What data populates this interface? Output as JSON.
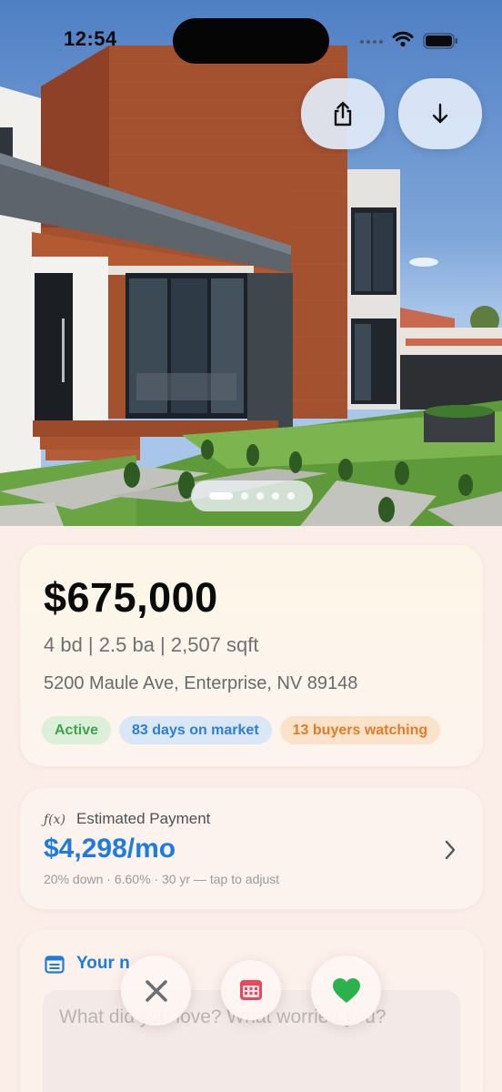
{
  "status_bar": {
    "time": "12:54"
  },
  "hero": {
    "photo_count": 5,
    "active_photo_index": 0,
    "share_icon": "share-icon",
    "download_icon": "arrow-down-icon"
  },
  "listing": {
    "price": "$675,000",
    "specs": "4 bd | 2.5 ba | 2,507 sqft",
    "address": "5200 Maule Ave, Enterprise, NV 89148",
    "badges": {
      "status": "Active",
      "days_on_market": "83 days on market",
      "buyers_watching": "13 buyers watching"
    }
  },
  "payment": {
    "icon": "ƒ(x)",
    "label": "Estimated Payment",
    "amount": "$4,298/mo",
    "details": "20% down · 6.60% · 30 yr — tap to adjust"
  },
  "notes": {
    "title": "Your n",
    "placeholder": "What did you love? What worried you?"
  },
  "actions": {
    "pass_icon": "close-icon",
    "schedule_icon": "calendar-icon",
    "like_icon": "heart-icon"
  },
  "colors": {
    "accent_blue": "#1e7be0",
    "active_green": "#3fa34a",
    "watch_orange": "#e07d26",
    "like_green": "#2bb24c",
    "calendar_red": "#e8475e",
    "background": "#fbeee9"
  }
}
